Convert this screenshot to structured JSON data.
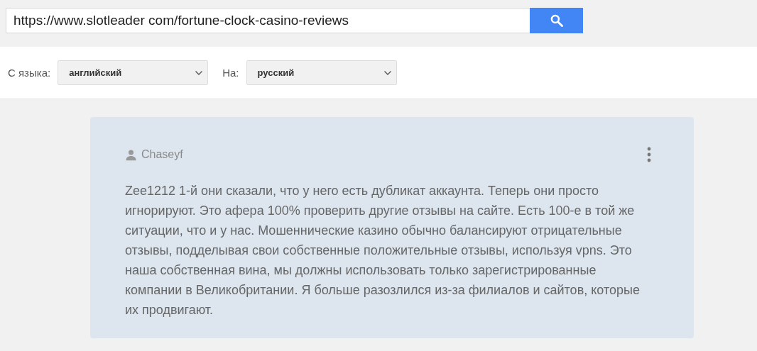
{
  "search": {
    "value": "https://www.slotleader com/fortune-clock-casino-reviews"
  },
  "languages": [
    {
      "label": "С языка:",
      "value": "английский"
    },
    {
      "label": "На:",
      "value": "русский"
    }
  ],
  "review": {
    "author": "Chaseyf",
    "text": "Zee1212 1-й они сказали, что у него есть дубликат аккаунта. Теперь они просто игнорируют. Это афера 100% проверить другие отзывы на сайте. Есть 100-е в той же ситуации, что и у нас. Мошеннические казино обычно балансируют отрицательные отзывы, подделывая свои собственные положительные отзывы, используя vpns. Это наша собственная вина, мы должны использовать только зарегистрированные компании в Великобритании. Я больше разозлился из-за филиалов и сайтов, которые их продвигают."
  }
}
